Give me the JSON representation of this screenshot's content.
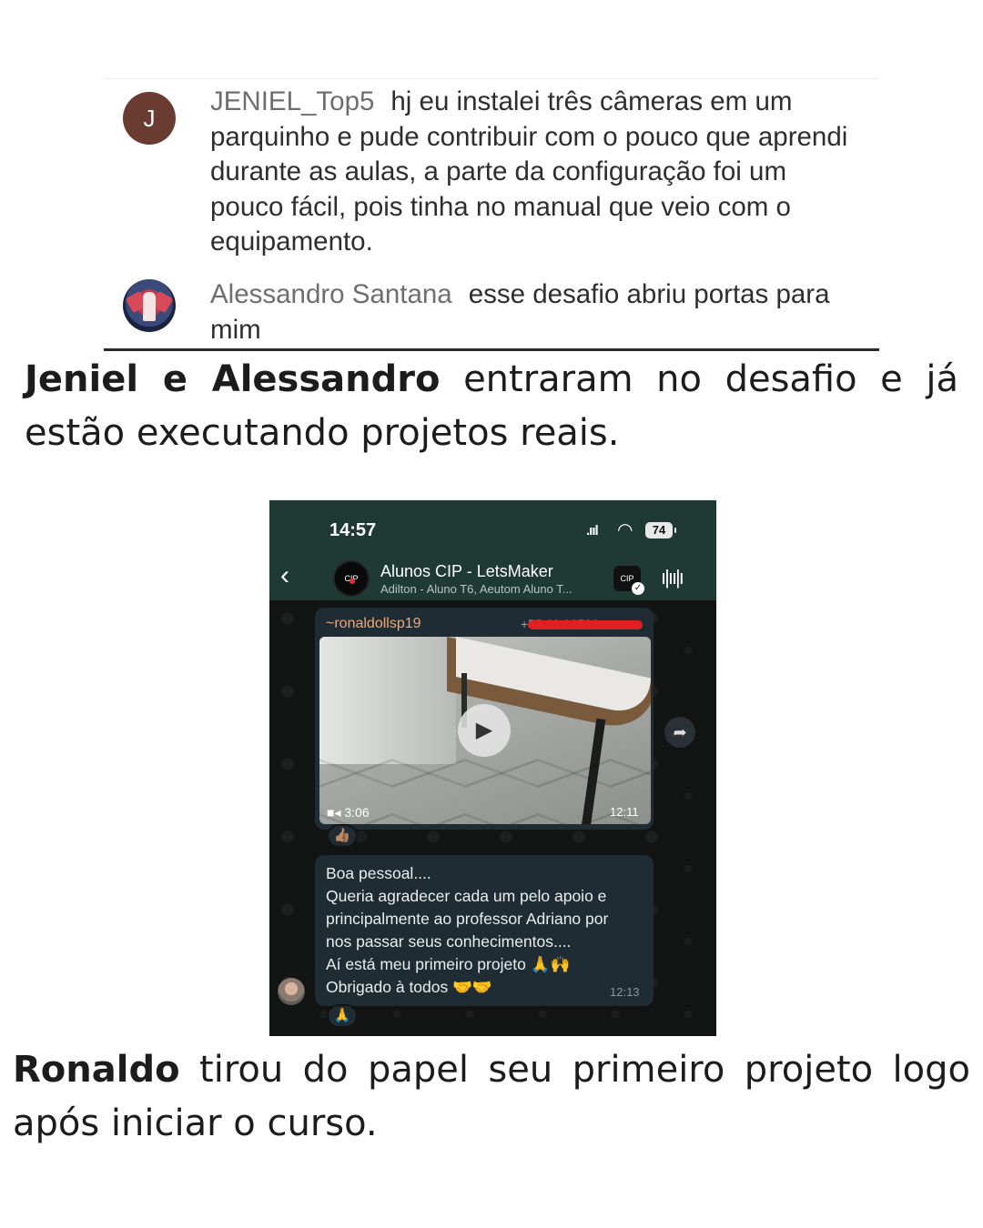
{
  "comments": [
    {
      "avatar_letter": "J",
      "author": "JENIEL_Top5",
      "text": "hj eu instalei três câmeras em um parquinho e pude contribuir com o pouco que aprendi durante as aulas, a parte da configuração foi um pouco fácil, pois tinha no manual que veio com o equipamento."
    },
    {
      "author": "Alessandro Santana",
      "text": "esse desafio abriu portas para mim"
    }
  ],
  "caption1": {
    "bold": "Jeniel e Alessandro",
    "rest": " entraram no desafio e já estão executando projetos reais."
  },
  "phone": {
    "status": {
      "time": "14:57",
      "battery": "74"
    },
    "group": {
      "name": "Alunos CIP - LetsMaker",
      "members": "Adilton - Aluno T6, Aeutom Aluno T..."
    },
    "video_message": {
      "sender": "~ronaldollsp19",
      "sender_phone": "+55 00 00500",
      "duration": "3:06",
      "time": "12:11",
      "reaction": "👍🏽"
    },
    "text_message": {
      "lines": [
        "Boa pessoal....",
        "Queria agradecer cada um pelo apoio e",
        "principalmente ao professor Adriano por",
        "nos passar seus conhecimentos....",
        "Aí está meu primeiro projeto 🙏🙌",
        "Obrigado à todos 🤝🤝"
      ],
      "time": "12:13",
      "reaction": "🙏"
    }
  },
  "caption2": {
    "bold": "Ronaldo",
    "rest": " tirou do papel seu primeiro projeto logo após iniciar o curso."
  }
}
